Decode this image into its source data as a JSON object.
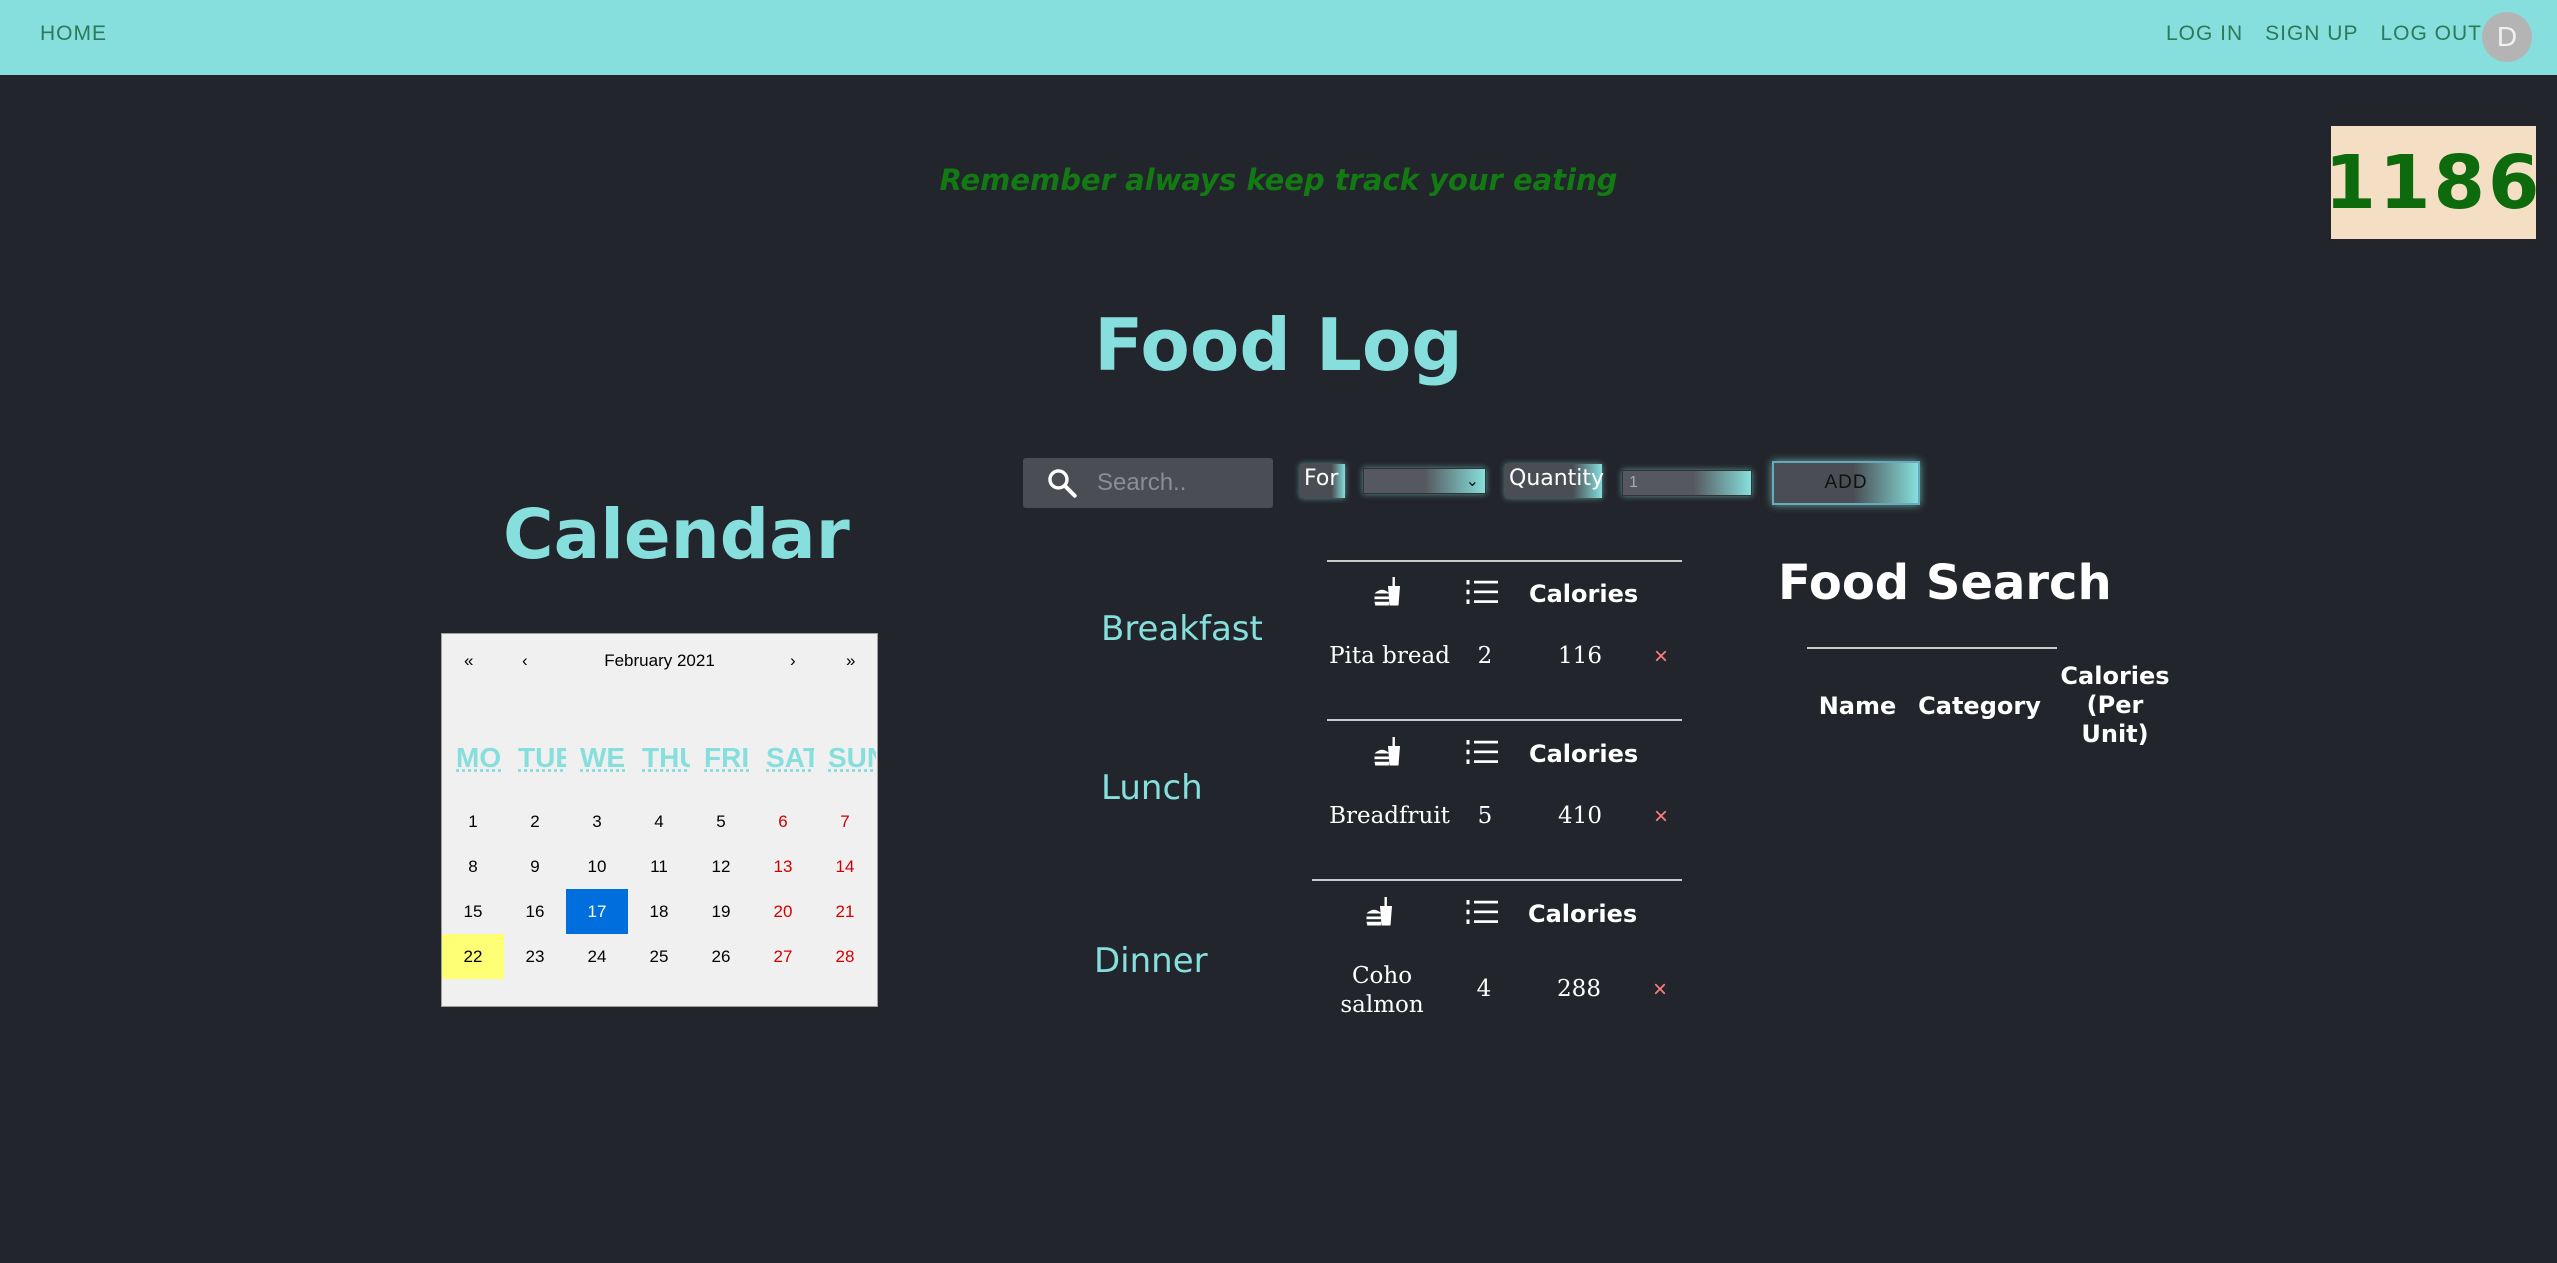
{
  "nav": {
    "home": "HOME",
    "login": "LOG IN",
    "signup": "SIGN UP",
    "logout": "LOG OUT",
    "avatar_initial": "D"
  },
  "motto": "Remember always keep track your eating",
  "calorie_total": "1186",
  "page_title": "Food Log",
  "controls": {
    "search_placeholder": "Search..",
    "for_label": "For",
    "meal_select_value": "",
    "quantity_label": "Quantity",
    "quantity_value": "1",
    "add_label": "ADD"
  },
  "calendar": {
    "title": "Calendar",
    "nav": {
      "double_prev": "«",
      "prev": "‹",
      "month": "February 2021",
      "next": "›",
      "double_next": "»"
    },
    "weekdays": [
      "MO",
      "TUE",
      "WE",
      "THU",
      "FRI",
      "SAT",
      "SUN"
    ],
    "days": [
      "1",
      "2",
      "3",
      "4",
      "5",
      "6",
      "7",
      "8",
      "9",
      "10",
      "11",
      "12",
      "13",
      "14",
      "15",
      "16",
      "17",
      "18",
      "19",
      "20",
      "21",
      "22",
      "23",
      "24",
      "25",
      "26",
      "27",
      "28"
    ],
    "selected_day": "17",
    "today": "22"
  },
  "table_header": {
    "calories": "Calories"
  },
  "meals": [
    {
      "label": "Breakfast",
      "food": "Pita bread",
      "qty": "2",
      "calories": "116",
      "remove": "×"
    },
    {
      "label": "Lunch",
      "food": "Breadfruit",
      "qty": "5",
      "calories": "410",
      "remove": "×"
    },
    {
      "label": "Dinner",
      "food": "Coho salmon",
      "qty": "4",
      "calories": "288",
      "remove": "×"
    }
  ],
  "food_search": {
    "title": "Food Search",
    "headers": [
      "Name",
      "Category",
      "Calories (Per Unit)"
    ]
  },
  "colors": {
    "nav_bg": "#86dfdc",
    "page_bg": "#22252b",
    "accent": "#86dfdc",
    "motto": "#137a13",
    "calorie_box_bg": "#f5dfc4",
    "calorie_box_text": "#0d6a0d",
    "selected_day": "#006edc",
    "today_highlight": "#ffff76",
    "remove": "#ff7f7f"
  },
  "icons": {
    "food_column": "burger-drink-icon",
    "qty_column": "numbered-list-icon",
    "search": "search-icon"
  }
}
